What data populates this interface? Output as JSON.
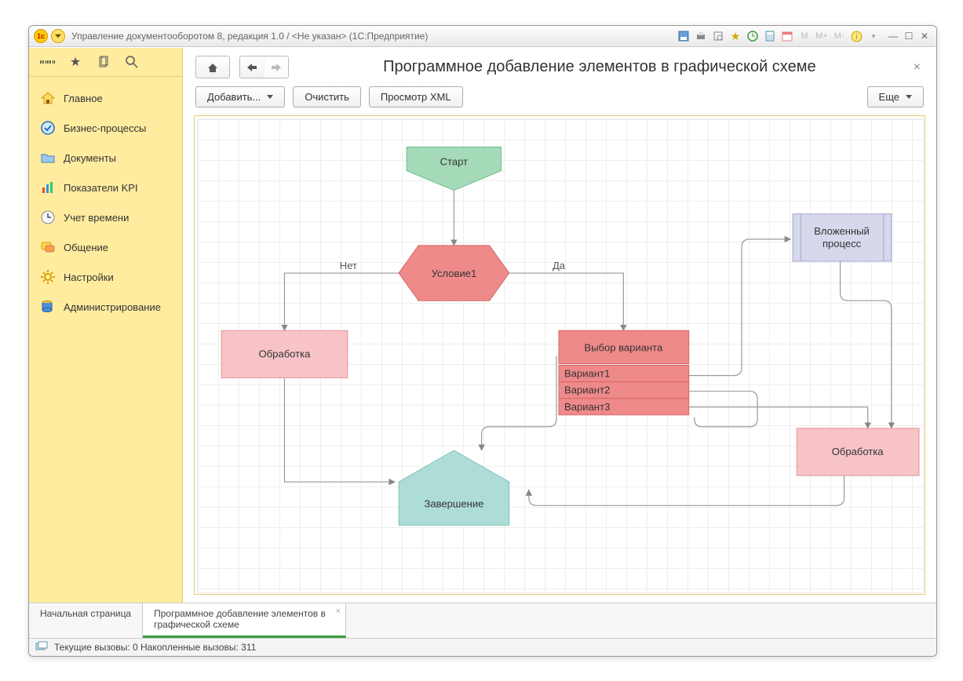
{
  "window": {
    "title": "Управление документооборотом 8, редакция 1.0 / <Не указан>  (1С:Предприятие)"
  },
  "sidebar": {
    "items": [
      {
        "label": "Главное"
      },
      {
        "label": "Бизнес-процессы"
      },
      {
        "label": "Документы"
      },
      {
        "label": "Показатели KPI"
      },
      {
        "label": "Учет времени"
      },
      {
        "label": "Общение"
      },
      {
        "label": "Настройки"
      },
      {
        "label": "Администрирование"
      }
    ]
  },
  "page": {
    "title": "Программное добавление элементов в графической схеме"
  },
  "toolbar": {
    "add": "Добавить...",
    "clear": "Очистить",
    "viewxml": "Просмотр XML",
    "more": "Еще"
  },
  "diagram": {
    "start": "Старт",
    "condition": "Условие1",
    "no": "Нет",
    "yes": "Да",
    "process_left": "Обработка",
    "choice": "Выбор варианта",
    "variant1": "Вариант1",
    "variant2": "Вариант2",
    "variant3": "Вариант3",
    "subprocess": "Вложенный процесс",
    "process_right": "Обработка",
    "end": "Завершение"
  },
  "tabs": {
    "home": "Начальная страница",
    "current": "Программное добавление элементов в графической схеме"
  },
  "status": {
    "text": "Текущие вызовы: 0   Накопленные вызовы: 311"
  }
}
